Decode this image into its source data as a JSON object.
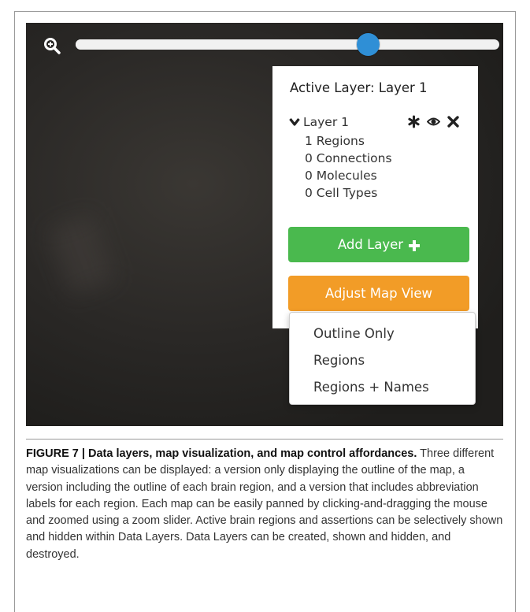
{
  "map": {
    "zoom_level": 0.69,
    "icons": {
      "zoom": "zoom-in-magnifier-icon"
    },
    "colors": {
      "slider_thumb": "#2f8fd6",
      "slider_track": "#f1f1f1",
      "background": "#2a2826"
    }
  },
  "layer_panel": {
    "title": "Active Layer: Layer 1",
    "layer": {
      "name": "Layer 1",
      "stats": [
        "1 Regions",
        "0 Connections",
        "0 Molecules",
        "0 Cell Types"
      ],
      "tools": [
        "asterisk-icon",
        "eye-icon",
        "close-icon"
      ]
    },
    "add_layer_label": "Add Layer",
    "adjust_view_label": "Adjust Map View",
    "colors": {
      "add_button": "#4ab94e",
      "adjust_button": "#f29c27"
    }
  },
  "view_menu": {
    "options": [
      "Outline Only",
      "Regions",
      "Regions + Names"
    ]
  },
  "caption": {
    "label": "FIGURE 7 | Data layers, map visualization, and map control affordances.",
    "text": " Three different map visualizations can be displayed: a version only displaying the outline of the map, a version including the outline of each brain region, and a version that includes abbreviation labels for each region. Each map can be easily panned by clicking-and-dragging the mouse and zoomed using a zoom slider. Active brain regions and assertions can be selectively shown and hidden within Data Layers. Data Layers can be created, shown and hidden, and destroyed."
  }
}
